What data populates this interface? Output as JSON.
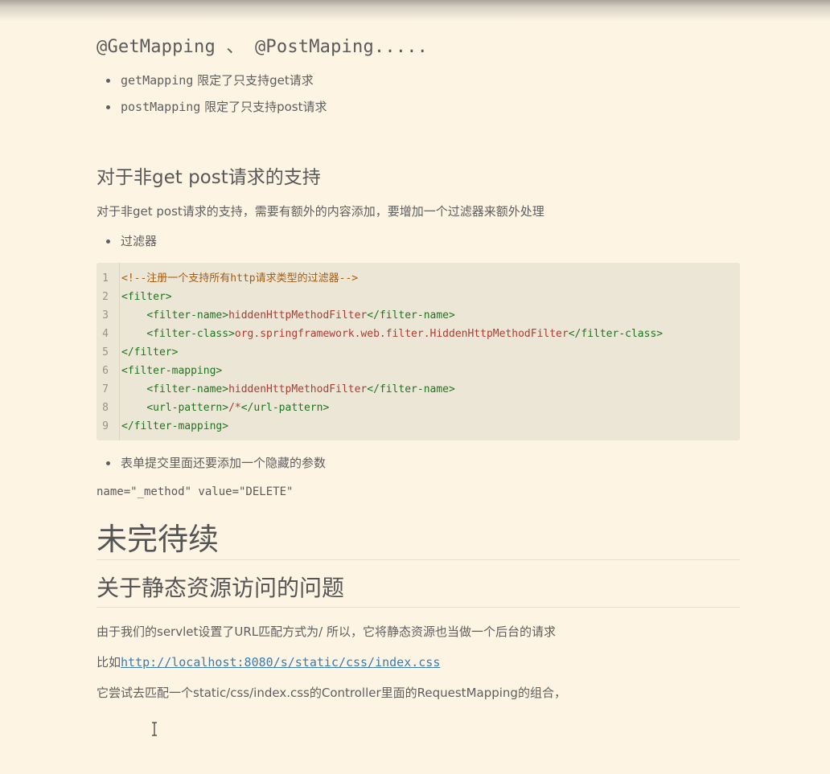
{
  "section_mapping": {
    "heading": "@GetMapping 、 @PostMaping.....",
    "bullets": [
      {
        "code": "getMapping",
        "text": " 限定了只支持get请求"
      },
      {
        "code": "postMapping",
        "text": " 限定了只支持post请求"
      }
    ]
  },
  "section_nonget": {
    "heading": "对于非get post请求的支持",
    "paragraph": "对于非get post请求的支持，需要有额外的内容添加，要增加一个过滤器来额外处理",
    "bullet_filter": "过滤器",
    "code_lines": [
      {
        "num": "1",
        "parts": [
          {
            "t": "c-comment",
            "v": "<!--注册一个支持所有http请求类型的过滤器-->"
          }
        ]
      },
      {
        "num": "2",
        "parts": [
          {
            "t": "c-tag",
            "v": "<filter>"
          }
        ]
      },
      {
        "num": "3",
        "parts": [
          {
            "t": "plain",
            "v": "    "
          },
          {
            "t": "c-tag",
            "v": "<filter-name>"
          },
          {
            "t": "c-text",
            "v": "hiddenHttpMethodFilter"
          },
          {
            "t": "c-tag",
            "v": "</filter-name>"
          }
        ]
      },
      {
        "num": "4",
        "parts": [
          {
            "t": "plain",
            "v": "    "
          },
          {
            "t": "c-tag",
            "v": "<filter-class>"
          },
          {
            "t": "c-text",
            "v": "org.springframework.web.filter.HiddenHttpMethodFilter"
          },
          {
            "t": "c-tag",
            "v": "</filter-class>"
          }
        ]
      },
      {
        "num": "5",
        "parts": [
          {
            "t": "c-tag",
            "v": "</filter>"
          }
        ]
      },
      {
        "num": "6",
        "parts": [
          {
            "t": "c-tag",
            "v": "<filter-mapping>"
          }
        ]
      },
      {
        "num": "7",
        "parts": [
          {
            "t": "plain",
            "v": "    "
          },
          {
            "t": "c-tag",
            "v": "<filter-name>"
          },
          {
            "t": "c-text",
            "v": "hiddenHttpMethodFilter"
          },
          {
            "t": "c-tag",
            "v": "</filter-name>"
          }
        ]
      },
      {
        "num": "8",
        "parts": [
          {
            "t": "plain",
            "v": "    "
          },
          {
            "t": "c-tag",
            "v": "<url-pattern>"
          },
          {
            "t": "c-text",
            "v": "/*"
          },
          {
            "t": "c-tag",
            "v": "</url-pattern>"
          }
        ]
      },
      {
        "num": "9",
        "parts": [
          {
            "t": "c-tag",
            "v": "</filter-mapping>"
          }
        ]
      }
    ],
    "bullet_hidden_param": "表单提交里面还要添加一个隐藏的参数",
    "inline_code": "name=\"_method\" value=\"DELETE\""
  },
  "heading_tbc": "未完待续",
  "section_static": {
    "heading": "关于静态资源访问的问题",
    "paragraph_servlet": "由于我们的servlet设置了URL匹配方式为/ 所以，它将静态资源也当做一个后台的请求",
    "example_prefix": "比如",
    "example_link": "http://localhost:8080/s/static/css/index.css",
    "paragraph_try": "它尝试去匹配一个static/css/index.css的Controller里面的RequestMapping的组合，"
  },
  "colors": {
    "background": "#fdf4e4",
    "code_background": "#ece6d6",
    "link": "#3a7cb0",
    "code_comment": "#a75c11",
    "code_tag": "#227320",
    "code_text": "#b03b30"
  },
  "icons": {
    "cursor": "text-cursor-icon"
  }
}
